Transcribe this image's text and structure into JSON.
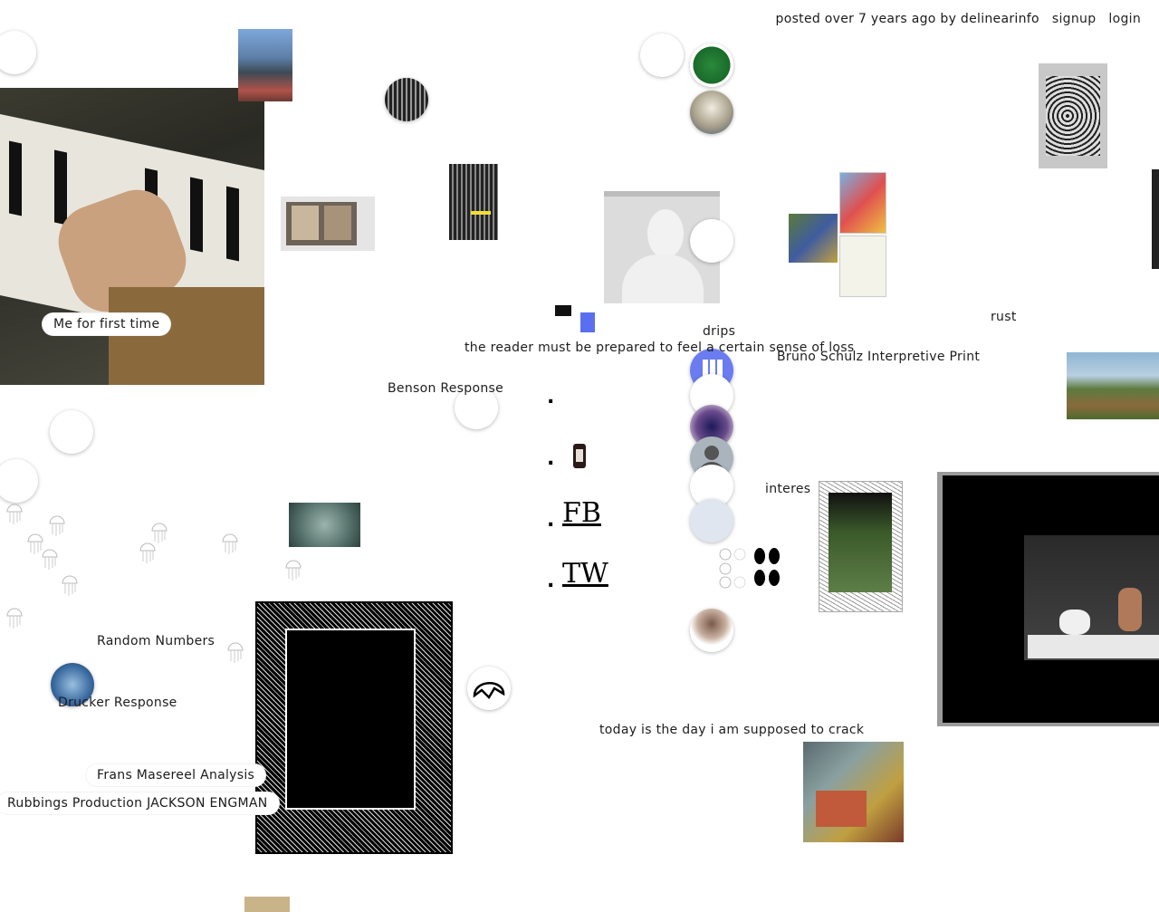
{
  "topbar": {
    "posted": "posted over 7 years ago by delinearinfo",
    "signup": "signup",
    "login": "login"
  },
  "labels": {
    "me_first_time": "Me for first time",
    "drips": "drips",
    "reader": "the reader must be prepared to feel a certain sense of loss",
    "rust": "rust",
    "schulz": "Bruno Schulz Interpretive Print",
    "benson": "Benson Response",
    "interes": "interes",
    "random_numbers": "Random Numbers",
    "drucker": "Drucker Response",
    "masereel": "Frans Masereel Analysis",
    "rubbings": "Rubbings Production JACKSON ENGMAN",
    "today": "today is the day i am supposed to crack"
  },
  "links": {
    "fb": "FB",
    "tw": "TW",
    "bullet": "."
  },
  "colors": {
    "background": "#ffffff",
    "text": "#1d1d1d",
    "blue_accent": "#5a6ff0"
  }
}
